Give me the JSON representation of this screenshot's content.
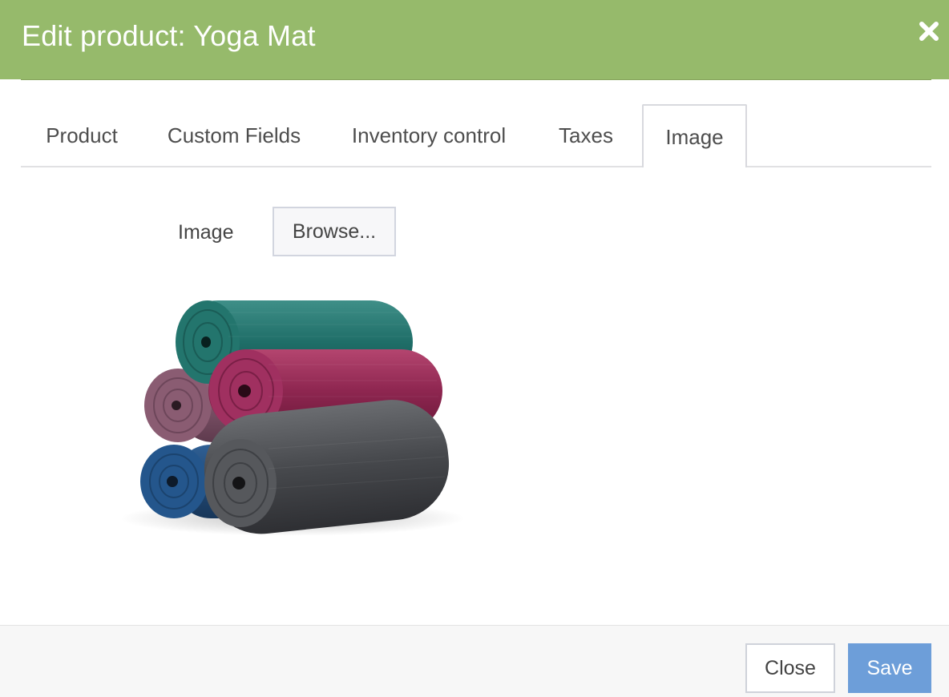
{
  "header": {
    "title": "Edit product: Yoga Mat",
    "close_icon": "close-icon",
    "background_color": "#96ba6b"
  },
  "tabs": [
    {
      "label": "Product",
      "active": false
    },
    {
      "label": "Custom Fields",
      "active": false
    },
    {
      "label": "Inventory control",
      "active": false
    },
    {
      "label": "Taxes",
      "active": false
    },
    {
      "label": "Image",
      "active": true
    }
  ],
  "image_section": {
    "label": "Image",
    "browse_label": "Browse...",
    "preview": "yoga-mats-stack"
  },
  "footer": {
    "close_label": "Close",
    "save_label": "Save",
    "save_color": "#6d9ed9"
  }
}
